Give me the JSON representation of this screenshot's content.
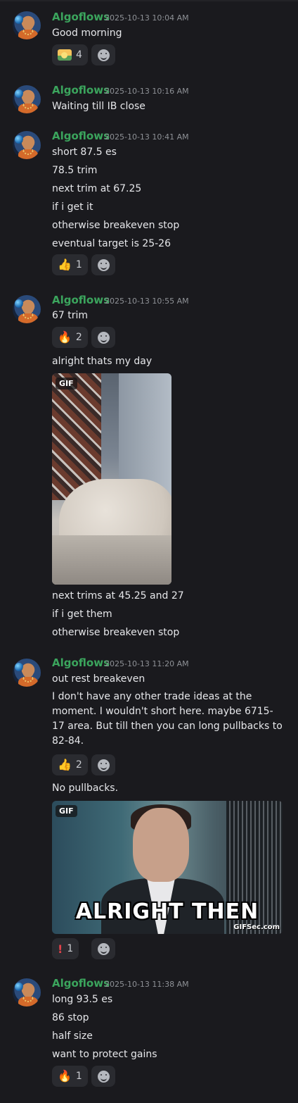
{
  "user": {
    "name": "Algoflows"
  },
  "groups": [
    {
      "timestamp": "2025-10-13 10:04 AM",
      "lines": [
        "Good morning"
      ],
      "reaction": {
        "emoji": "sunrise",
        "count": "4"
      }
    },
    {
      "timestamp": "2025-10-13 10:16 AM",
      "lines": [
        "Waiting till IB close"
      ]
    },
    {
      "timestamp": "2025-10-13 10:41 AM",
      "lines": [
        "short 87.5 es",
        "78.5 trim",
        "next trim at 67.25",
        "if i get it",
        "otherwise breakeven stop",
        "eventual target is 25-26"
      ],
      "reaction": {
        "emoji": "👍",
        "count": "1"
      }
    },
    {
      "timestamp": "2025-10-13 10:55 AM",
      "lines": [
        "67 trim"
      ],
      "reaction": {
        "emoji": "🔥",
        "count": "2"
      },
      "followups": [
        "alright thats my day"
      ],
      "gif": {
        "badge": "GIF"
      },
      "after_gif": [
        "next trims at 45.25 and 27",
        "if i get them",
        "otherwise breakeven stop"
      ]
    },
    {
      "timestamp": "2025-10-13 11:20 AM",
      "lines": [
        "out rest breakeven"
      ],
      "paragraph": "I don't have any other trade ideas at the moment. I wouldn't short here. maybe 6715-17 area. But till then you can long pullbacks to 82-84.",
      "reaction": {
        "emoji": "👍",
        "count": "2"
      },
      "followups": [
        "No pullbacks."
      ],
      "gif": {
        "badge": "GIF",
        "caption": "ALRIGHT THEN",
        "watermark": "GIFSec.com"
      },
      "reaction2": {
        "emoji": "!",
        "count": "1"
      }
    },
    {
      "timestamp": "2025-10-13 11:38 AM",
      "lines": [
        "long 93.5 es",
        "86 stop",
        "half size",
        "want to protect gains"
      ],
      "reaction": {
        "emoji": "🔥",
        "count": "1"
      }
    }
  ]
}
